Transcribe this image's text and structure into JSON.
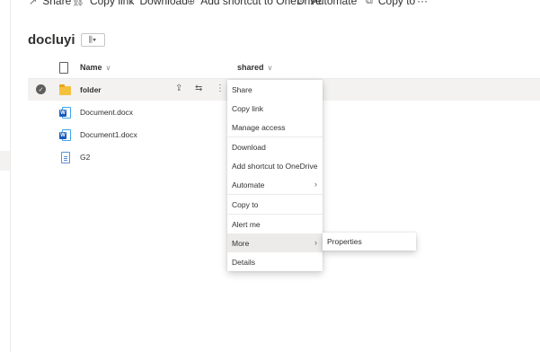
{
  "command_bar": {
    "items": [
      {
        "label": "Share",
        "icon": "share-icon"
      },
      {
        "label": "Copy link",
        "icon": "link-icon"
      },
      {
        "label": "Download",
        "icon": "download-icon"
      },
      {
        "label": "Add shortcut to OneDrive",
        "icon": "shortcut-icon"
      },
      {
        "label": "Automate",
        "icon": "automate-icon"
      },
      {
        "label": "Copy to",
        "icon": "copy-icon"
      }
    ],
    "more": "···"
  },
  "library": {
    "title": "docluyi",
    "view_icon": "library-view-icon"
  },
  "list": {
    "columns": {
      "name": "Name",
      "shared": "shared"
    },
    "rows": [
      {
        "name": "folder",
        "type": "folder",
        "selected": true
      },
      {
        "name": "Document.docx",
        "type": "word"
      },
      {
        "name": "Document1.docx",
        "type": "word"
      },
      {
        "name": "G2",
        "type": "page"
      }
    ]
  },
  "context_menu": {
    "items": [
      {
        "label": "Share"
      },
      {
        "label": "Copy link"
      },
      {
        "label": "Manage access"
      },
      {
        "label": "Download"
      },
      {
        "label": "Add shortcut to OneDrive"
      },
      {
        "label": "Automate",
        "submenu": true
      },
      {
        "label": "Copy to"
      },
      {
        "label": "Alert me"
      },
      {
        "label": "More",
        "submenu": true,
        "hover": true
      },
      {
        "label": "Details"
      }
    ]
  },
  "submenu": {
    "items": [
      {
        "label": "Properties"
      }
    ]
  },
  "colors": {
    "folder": "#f4c13d",
    "word": "#185abd",
    "selected_row": "#f3f2f1",
    "menu_hover": "#edebe9"
  }
}
